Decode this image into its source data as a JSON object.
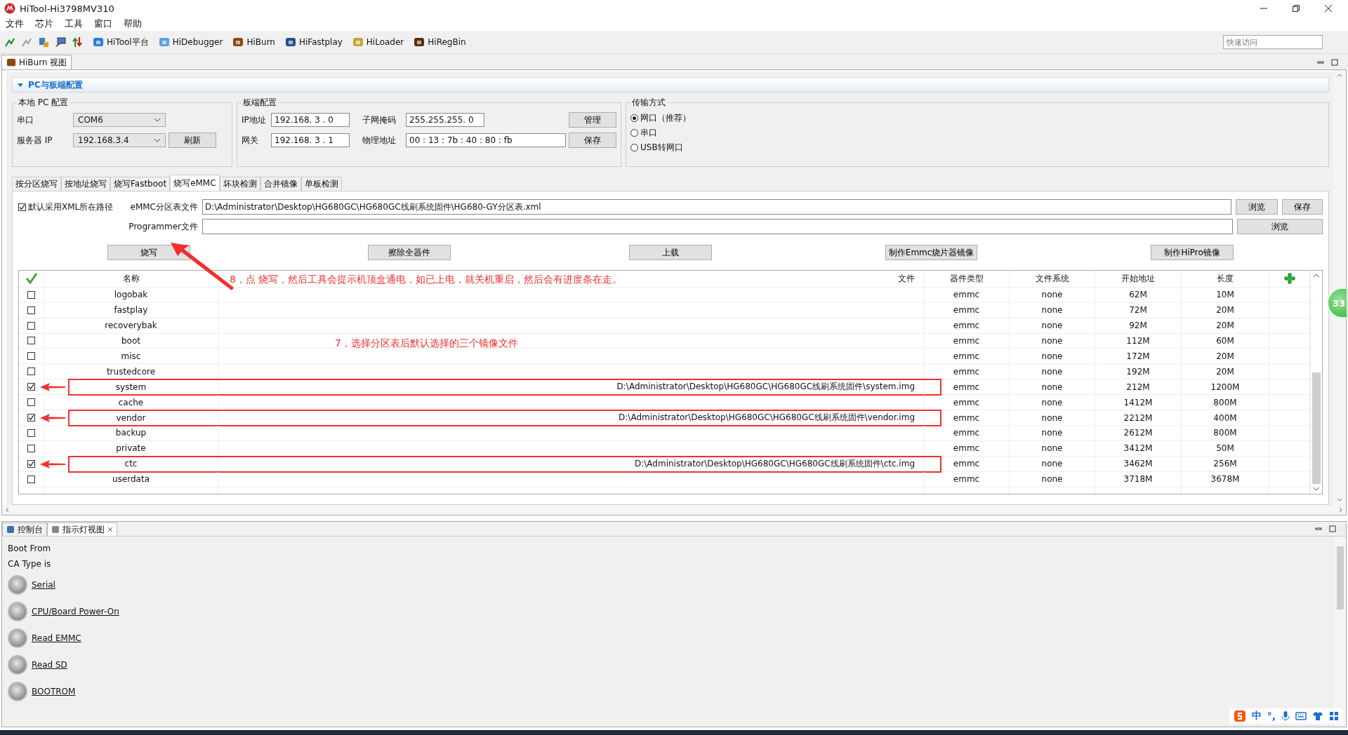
{
  "window": {
    "title": "HiTool-Hi3798MV310"
  },
  "menu": [
    "文件",
    "芯片",
    "工具",
    "窗口",
    "帮助"
  ],
  "tools": [
    {
      "label": "HiTool平台"
    },
    {
      "label": "HiDebugger"
    },
    {
      "label": "HiBurn"
    },
    {
      "label": "HiFastplay"
    },
    {
      "label": "HiLoader"
    },
    {
      "label": "HiRegBin"
    }
  ],
  "quick_access": {
    "placeholder": "快速访问"
  },
  "view_tab": {
    "label": "HiBurn 视图"
  },
  "section": {
    "title": "PC与板端配置",
    "expanded": true
  },
  "local_pc": {
    "legend": "本地 PC 配置",
    "serial_label": "串口",
    "serial_value": "COM6",
    "server_label": "服务器 IP",
    "server_value": "192.168.3.4",
    "refresh_button": "刷新"
  },
  "board": {
    "legend": "板端配置",
    "ip_label": "IP地址",
    "ip_value": "192.168. 3 . 0",
    "mask_label": "子网掩码",
    "mask_value": "255.255.255. 0",
    "gateway_label": "网关",
    "gateway_value": "192.168. 3 . 1",
    "mac_label": "物理地址",
    "mac_value": "00 : 13 : 7b : 40 : 80 : fb",
    "manage_button": "管理",
    "save_button": "保存"
  },
  "transfer": {
    "legend": "传输方式",
    "options": [
      {
        "label": "网口（推荐）",
        "selected": true
      },
      {
        "label": "串口",
        "selected": false
      },
      {
        "label": "USB转网口",
        "selected": false
      }
    ]
  },
  "tabs": [
    {
      "label": "按分区烧写",
      "selected": false
    },
    {
      "label": "按地址烧写",
      "selected": false
    },
    {
      "label": "烧写Fastboot",
      "selected": false
    },
    {
      "label": "烧写eMMC",
      "selected": true
    },
    {
      "label": "坏块检测",
      "selected": false
    },
    {
      "label": "合并镜像",
      "selected": false
    },
    {
      "label": "单板检测",
      "selected": false
    }
  ],
  "emmc": {
    "use_xml_path": {
      "label": "默认采用XML所在路径",
      "checked": true
    },
    "partition_label": "eMMC分区表文件",
    "partition_value": "D:\\Administrator\\Desktop\\HG680GC\\HG680GC线刷系统固件\\HG680-GY分区表.xml",
    "browse_button": "浏览",
    "save_button": "保存",
    "programmer_label": "Programmer文件",
    "programmer_browse_button": "浏览"
  },
  "actions": [
    "烧写",
    "擦除全器件",
    "上载",
    "制作Emmc烧片器镜像",
    "制作HiPro镜像"
  ],
  "table": {
    "columns": [
      "名称",
      "文件",
      "器件类型",
      "文件系统",
      "开始地址",
      "长度"
    ],
    "rows": [
      {
        "checked": false,
        "highlighted": false,
        "name": "logobak",
        "type": "emmc",
        "fs": "none",
        "start": "62M",
        "length": "10M"
      },
      {
        "checked": false,
        "highlighted": false,
        "name": "fastplay",
        "type": "emmc",
        "fs": "none",
        "start": "72M",
        "length": "20M"
      },
      {
        "checked": false,
        "highlighted": false,
        "name": "recoverybak",
        "type": "emmc",
        "fs": "none",
        "start": "92M",
        "length": "20M"
      },
      {
        "checked": false,
        "highlighted": false,
        "name": "boot",
        "type": "emmc",
        "fs": "none",
        "start": "112M",
        "length": "60M"
      },
      {
        "checked": false,
        "highlighted": false,
        "name": "misc",
        "type": "emmc",
        "fs": "none",
        "start": "172M",
        "length": "20M"
      },
      {
        "checked": false,
        "highlighted": false,
        "name": "trustedcore",
        "type": "emmc",
        "fs": "none",
        "start": "192M",
        "length": "20M"
      },
      {
        "checked": true,
        "highlighted": true,
        "name": "system",
        "file": "D:\\Administrator\\Desktop\\HG680GC\\HG680GC线刷系统固件\\system.img",
        "type": "emmc",
        "fs": "none",
        "start": "212M",
        "length": "1200M"
      },
      {
        "checked": false,
        "highlighted": false,
        "name": "cache",
        "type": "emmc",
        "fs": "none",
        "start": "1412M",
        "length": "800M"
      },
      {
        "checked": true,
        "highlighted": true,
        "name": "vendor",
        "file": "D:\\Administrator\\Desktop\\HG680GC\\HG680GC线刷系统固件\\vendor.img",
        "type": "emmc",
        "fs": "none",
        "start": "2212M",
        "length": "400M"
      },
      {
        "checked": false,
        "highlighted": false,
        "name": "backup",
        "type": "emmc",
        "fs": "none",
        "start": "2612M",
        "length": "800M"
      },
      {
        "checked": false,
        "highlighted": false,
        "name": "private",
        "type": "emmc",
        "fs": "none",
        "start": "3412M",
        "length": "50M"
      },
      {
        "checked": true,
        "highlighted": true,
        "name": "ctc",
        "file": "D:\\Administrator\\Desktop\\HG680GC\\HG680GC线刷系统固件\\ctc.img",
        "type": "emmc",
        "fs": "none",
        "start": "3462M",
        "length": "256M"
      },
      {
        "checked": false,
        "highlighted": false,
        "name": "userdata",
        "type": "emmc",
        "fs": "none",
        "start": "3718M",
        "length": "3678M"
      }
    ]
  },
  "annotations": [
    {
      "kind": "arrow-note",
      "text": "8，点 烧写，然后工具会提示机顶盒通电，如已上电，就关机重启，然后会有进度条在走。"
    },
    {
      "kind": "note",
      "text": "7，选择分区表后默认选择的三个镜像文件"
    }
  ],
  "console": {
    "tabs": [
      {
        "label": "控制台",
        "selected": false
      },
      {
        "label": "指示灯视图",
        "selected": true
      }
    ],
    "lines": [
      "Boot From",
      "CA Type is"
    ],
    "lights": [
      {
        "label": "Serial",
        "on": false
      },
      {
        "label": "CPU/Board Power-On",
        "on": false
      },
      {
        "label": "Read EMMC",
        "on": false
      },
      {
        "label": "Read SD ",
        "on": false
      },
      {
        "label": "BOOTROM",
        "on": false
      }
    ]
  },
  "speed_ball": "33",
  "ime": [
    "中",
    "°,"
  ]
}
